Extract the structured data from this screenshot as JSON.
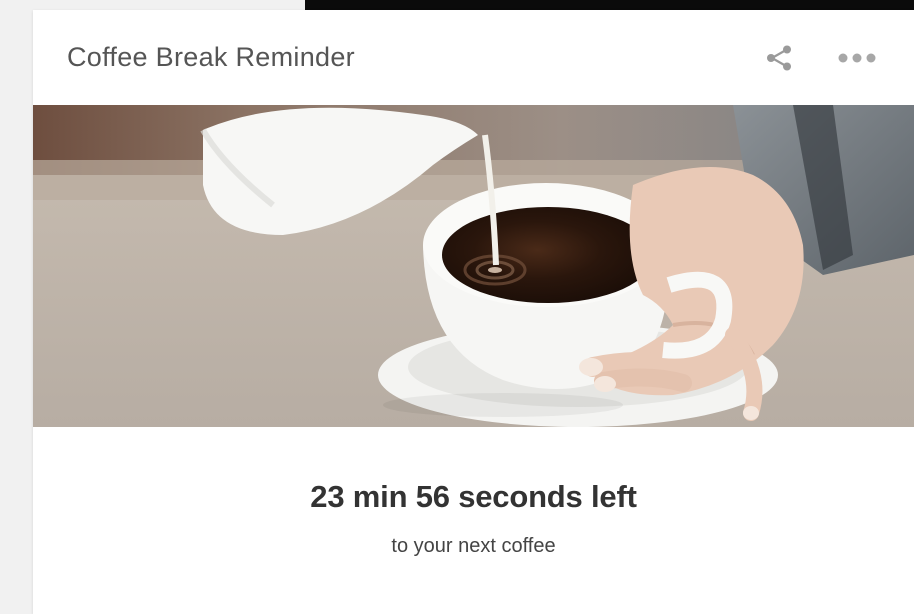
{
  "card": {
    "title": "Coffee Break Reminder",
    "countdown": "23 min 56 seconds left",
    "subtitle": "to your next coffee"
  },
  "icons": {
    "share": "share-icon",
    "more": "more-options-icon"
  },
  "image": {
    "subject": "milk being poured into a cup of coffee"
  },
  "colors": {
    "title_text": "#555555",
    "countdown_text": "#333333",
    "icon": "#9a9a9a"
  }
}
